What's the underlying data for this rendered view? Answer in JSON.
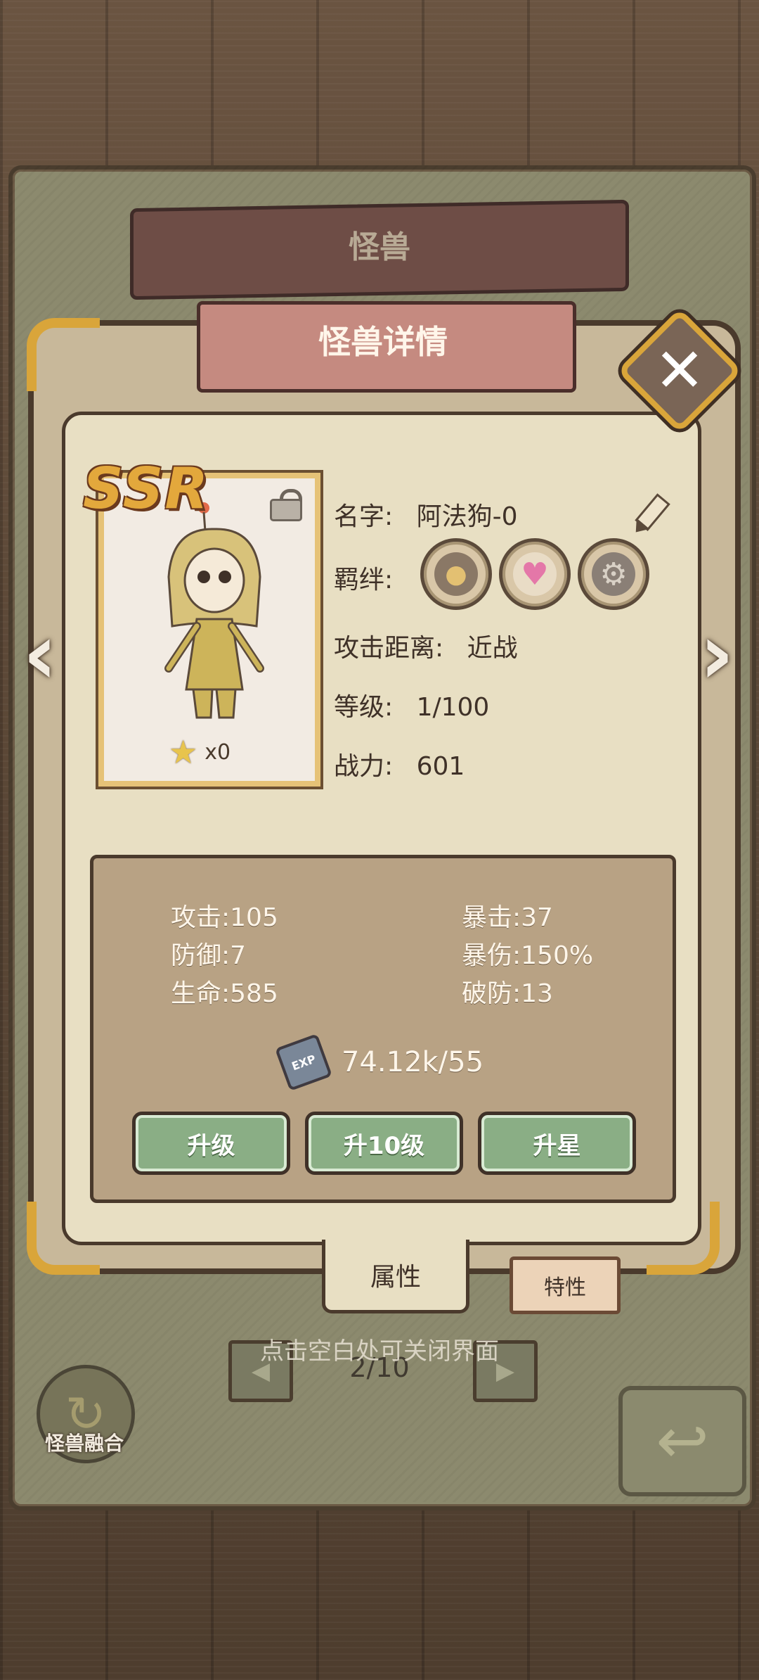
{
  "header": {
    "back_title": "怪兽",
    "title": "怪兽详情"
  },
  "card": {
    "rarity": "SSR",
    "star_count": "x0"
  },
  "info": {
    "name_label": "名字:",
    "name_value": "阿法狗-0",
    "bond_label": "羁绊:",
    "range_label": "攻击距离:",
    "range_value": "近战",
    "level_label": "等级:",
    "level_value": "1/100",
    "power_label": "战力:",
    "power_value": "601"
  },
  "bonds": [
    {
      "icon": "paw-icon",
      "glyph": "🐾"
    },
    {
      "icon": "heart-icon",
      "glyph": "♥"
    },
    {
      "icon": "gear-icon",
      "glyph": "⚙"
    }
  ],
  "stats": {
    "attack": "攻击:105",
    "defense": "防御:7",
    "hp": "生命:585",
    "crit": "暴击:37",
    "crit_dmg": "暴伤:150%",
    "armor_pen": "破防:13",
    "exp": "74.12k/55",
    "exp_icon_label": "EXP"
  },
  "buttons": {
    "level_up": "升级",
    "level_up_10": "升10级",
    "star_up": "升星"
  },
  "tabs": {
    "attributes": "属性",
    "traits": "特性"
  },
  "footer": {
    "hint": "点击空白处可关闭界面",
    "page": "2/10",
    "fusion_label": "怪兽融合"
  },
  "colors": {
    "accent_gold": "#d9a53a",
    "button_green": "#8aae85",
    "ribbon_pink": "#c58a80"
  }
}
